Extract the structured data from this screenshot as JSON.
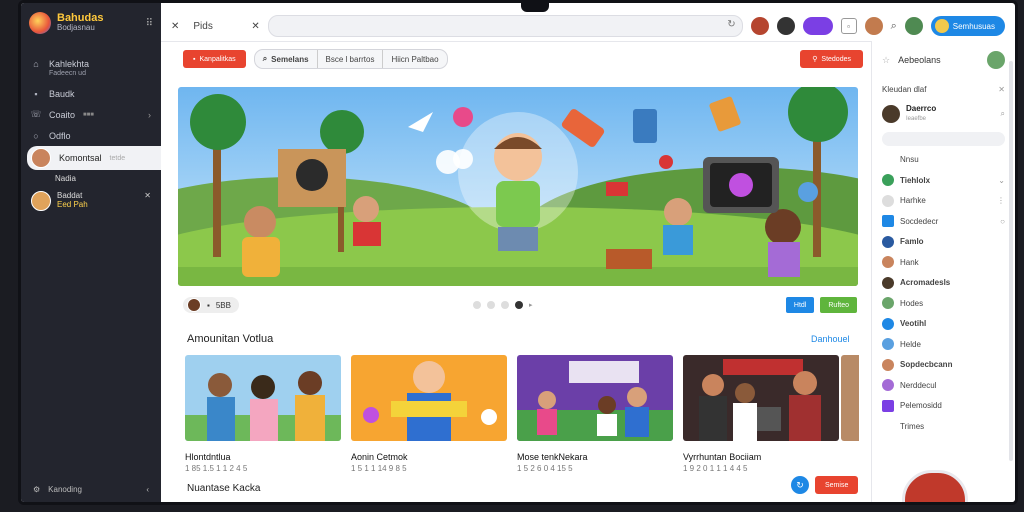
{
  "app": {
    "brand_title": "Bahudas",
    "brand_sub": "Bodjasnau",
    "menu_icon": "more-icon"
  },
  "sidebar": {
    "items": [
      {
        "icon": "home-icon",
        "label": "Kahlekhta",
        "sub": "Fadeecn ud"
      },
      {
        "icon": "grid-icon",
        "label": "Baudk"
      },
      {
        "icon": "phone-icon",
        "label": "Coaito",
        "badge": "■■■"
      },
      {
        "icon": "circle-icon",
        "label": "Odflo"
      }
    ],
    "active_chat": {
      "name": "Komontsal",
      "sub": "tetde"
    },
    "chat_extra": {
      "label": "Nadia"
    },
    "chat_unread": {
      "name": "Baddat",
      "sub": "Eed Pah"
    },
    "footer_label": "Kanoding"
  },
  "topbar": {
    "tab_label": "Pids",
    "signin_label": "Semhusuas"
  },
  "toolbar": {
    "left_btn": "Kanpalitkas",
    "chips": [
      "Semelans",
      "Bsce l barrtos",
      "Hiicn Paltbao"
    ],
    "right_btn": "Stedodes"
  },
  "hero": {
    "tag": "5BB",
    "btn_primary": "Htdl",
    "btn_secondary": "Rufteo",
    "colors": {
      "btn_primary": "#1e88e5",
      "btn_secondary": "#5fb53c"
    }
  },
  "section": {
    "title": "Amounitan Votlua",
    "link": "Danhouel",
    "cards": [
      {
        "title": "Hlontdntlua",
        "meta": "1 85 1.5 1 1 2 4 5"
      },
      {
        "title": "Aonin Cetmok",
        "meta": "1 5 1 1 14 9 8 5"
      },
      {
        "title": "Mose tenkNekara",
        "meta": "1 5 2 6 0 4 15 5"
      },
      {
        "title": "Vyrrhuntan Bociiam",
        "meta": "1 9 2 0 1 1 1 4 4 5"
      }
    ],
    "next_title": "Nuantase Kacka",
    "bottom_btn": "Semise"
  },
  "right_panel": {
    "header": "Aebeolans",
    "sub_header": "Kleudan dlaf",
    "featured": {
      "name": "Daerrco",
      "sub": "Ieaefbe"
    },
    "list": [
      {
        "label": "Nnsu",
        "type": "plain"
      },
      {
        "label": "Tiehlolx",
        "type": "bold"
      },
      {
        "label": "Harhke",
        "type": "plain"
      },
      {
        "label": "Socdedecr",
        "type": "plain"
      },
      {
        "label": "Famlo",
        "type": "bold"
      },
      {
        "label": "Hank",
        "type": "plain"
      },
      {
        "label": "Acromadesls",
        "type": "bold"
      },
      {
        "label": "Hodes",
        "type": "plain"
      },
      {
        "label": "Veotihl",
        "type": "bold"
      },
      {
        "label": "Helde",
        "type": "plain"
      },
      {
        "label": "Sopdecbcann",
        "type": "bold"
      },
      {
        "label": "Nerddecul",
        "type": "plain"
      },
      {
        "label": "Pelemosidd",
        "type": "plain"
      },
      {
        "label": "Trimes",
        "type": "plain"
      }
    ]
  }
}
